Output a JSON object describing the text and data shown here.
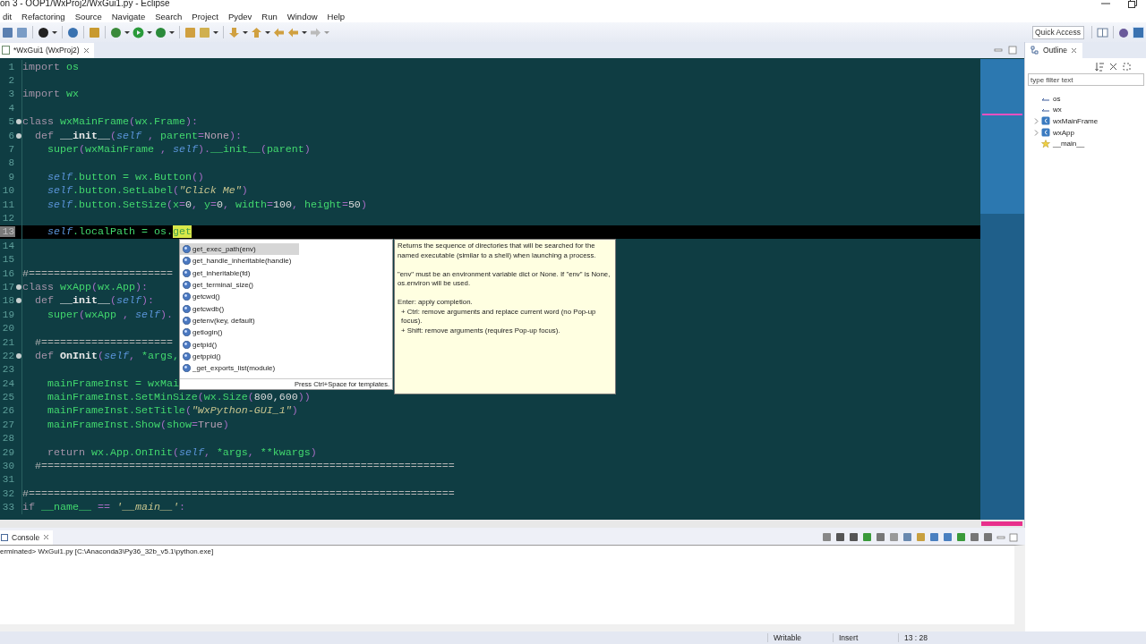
{
  "window": {
    "title": "on 3 - OOP1/WxProj2/WxGui1.py - Eclipse"
  },
  "menu": [
    "dit",
    "Refactoring",
    "Source",
    "Navigate",
    "Search",
    "Project",
    "Pydev",
    "Run",
    "Window",
    "Help"
  ],
  "quick_access": {
    "placeholder": "Quick Access"
  },
  "editor": {
    "tab": {
      "label": "*WxGui1 (WxProj2)",
      "selected": true
    },
    "lines": [
      {
        "n": "1",
        "fold": false,
        "current": false,
        "tokens": [
          {
            "t": "import ",
            "kind": "kw"
          },
          {
            "t": "os",
            "kind": "name"
          }
        ]
      },
      {
        "n": "2",
        "fold": false,
        "current": false
      },
      {
        "n": "3",
        "fold": false,
        "current": false,
        "tokens": [
          {
            "t": "import ",
            "kind": "kw"
          },
          {
            "t": "wx",
            "kind": "name"
          }
        ]
      },
      {
        "n": "4",
        "fold": false,
        "current": false
      },
      {
        "n": "5",
        "fold": true,
        "current": false,
        "tokens": [
          {
            "t": "class ",
            "kind": "kw"
          },
          {
            "t": "wxMainFrame",
            "kind": "name"
          },
          {
            "t": "(",
            "kind": "op"
          },
          {
            "t": "wx.Frame",
            "kind": "name"
          },
          {
            "t": "):",
            "kind": "op"
          }
        ]
      },
      {
        "n": "6",
        "fold": true,
        "current": false,
        "tokens": [
          {
            "t": "  def ",
            "kind": "kw"
          },
          {
            "t": "__init__",
            "kind": "fn"
          },
          {
            "t": "(",
            "kind": "op"
          },
          {
            "t": "self",
            "kind": "self"
          },
          {
            "t": " , ",
            "kind": "op"
          },
          {
            "t": "parent",
            "kind": "name"
          },
          {
            "t": "=",
            "kind": "op"
          },
          {
            "t": "None",
            "kind": "const"
          },
          {
            "t": "):",
            "kind": "op"
          }
        ]
      },
      {
        "n": "7",
        "fold": false,
        "current": false,
        "tokens": [
          {
            "t": "    super",
            "kind": "name"
          },
          {
            "t": "(",
            "kind": "op"
          },
          {
            "t": "wxMainFrame",
            "kind": "name"
          },
          {
            "t": " , ",
            "kind": "op"
          },
          {
            "t": "self",
            "kind": "self"
          },
          {
            "t": ").",
            "kind": "op"
          },
          {
            "t": "__init__",
            "kind": "name"
          },
          {
            "t": "(",
            "kind": "op"
          },
          {
            "t": "parent",
            "kind": "name"
          },
          {
            "t": ")",
            "kind": "op"
          }
        ]
      },
      {
        "n": "8",
        "fold": false,
        "current": false
      },
      {
        "n": "9",
        "fold": false,
        "current": false,
        "tokens": [
          {
            "t": "    self",
            "kind": "self"
          },
          {
            "t": ".button = wx.Button",
            "kind": "name"
          },
          {
            "t": "()",
            "kind": "op"
          }
        ]
      },
      {
        "n": "10",
        "fold": false,
        "current": false,
        "tokens": [
          {
            "t": "    self",
            "kind": "self"
          },
          {
            "t": ".button.SetLabel",
            "kind": "name"
          },
          {
            "t": "(",
            "kind": "op"
          },
          {
            "t": "\"Click Me\"",
            "kind": "str"
          },
          {
            "t": ")",
            "kind": "op"
          }
        ]
      },
      {
        "n": "11",
        "fold": false,
        "current": false,
        "tokens": [
          {
            "t": "    self",
            "kind": "self"
          },
          {
            "t": ".button.SetSize",
            "kind": "name"
          },
          {
            "t": "(",
            "kind": "op"
          },
          {
            "t": "x",
            "kind": "name"
          },
          {
            "t": "=",
            "kind": "op"
          },
          {
            "t": "0",
            "kind": "num"
          },
          {
            "t": ", ",
            "kind": "op"
          },
          {
            "t": "y",
            "kind": "name"
          },
          {
            "t": "=",
            "kind": "op"
          },
          {
            "t": "0",
            "kind": "num"
          },
          {
            "t": ", ",
            "kind": "op"
          },
          {
            "t": "width",
            "kind": "name"
          },
          {
            "t": "=",
            "kind": "op"
          },
          {
            "t": "100",
            "kind": "num"
          },
          {
            "t": ", ",
            "kind": "op"
          },
          {
            "t": "height",
            "kind": "name"
          },
          {
            "t": "=",
            "kind": "op"
          },
          {
            "t": "50",
            "kind": "num"
          },
          {
            "t": ")",
            "kind": "op"
          }
        ]
      },
      {
        "n": "12",
        "fold": false,
        "current": false
      },
      {
        "n": "13",
        "fold": false,
        "current": true,
        "tokens": [
          {
            "t": "    self",
            "kind": "self"
          },
          {
            "t": ".localPath = os.",
            "kind": "name"
          },
          {
            "t": "get",
            "kind": "hl"
          }
        ]
      },
      {
        "n": "14",
        "fold": false,
        "current": false
      },
      {
        "n": "15",
        "fold": false,
        "current": false
      },
      {
        "n": "16",
        "fold": false,
        "current": false,
        "tokens": [
          {
            "t": "#=======================",
            "kind": "comment"
          }
        ]
      },
      {
        "n": "17",
        "fold": true,
        "current": false,
        "tokens": [
          {
            "t": "class ",
            "kind": "kw"
          },
          {
            "t": "wxApp",
            "kind": "name"
          },
          {
            "t": "(",
            "kind": "op"
          },
          {
            "t": "wx.App",
            "kind": "name"
          },
          {
            "t": "):",
            "kind": "op"
          }
        ]
      },
      {
        "n": "18",
        "fold": true,
        "current": false,
        "tokens": [
          {
            "t": "  def ",
            "kind": "kw"
          },
          {
            "t": "__init__",
            "kind": "fn"
          },
          {
            "t": "(",
            "kind": "op"
          },
          {
            "t": "self",
            "kind": "self"
          },
          {
            "t": "):",
            "kind": "op"
          }
        ]
      },
      {
        "n": "19",
        "fold": false,
        "current": false,
        "tokens": [
          {
            "t": "    super",
            "kind": "name"
          },
          {
            "t": "(",
            "kind": "op"
          },
          {
            "t": "wxApp",
            "kind": "name"
          },
          {
            "t": " , ",
            "kind": "op"
          },
          {
            "t": "self",
            "kind": "self"
          },
          {
            "t": ").",
            "kind": "op"
          }
        ]
      },
      {
        "n": "20",
        "fold": false,
        "current": false
      },
      {
        "n": "21",
        "fold": false,
        "current": false,
        "tokens": [
          {
            "t": "  #=====================",
            "kind": "comment"
          }
        ]
      },
      {
        "n": "22",
        "fold": true,
        "current": false,
        "tokens": [
          {
            "t": "  def ",
            "kind": "kw"
          },
          {
            "t": "OnInit",
            "kind": "fn"
          },
          {
            "t": "(",
            "kind": "op"
          },
          {
            "t": "self",
            "kind": "self"
          },
          {
            "t": ", ",
            "kind": "op"
          },
          {
            "t": "*args,",
            "kind": "name"
          }
        ]
      },
      {
        "n": "23",
        "fold": false,
        "current": false
      },
      {
        "n": "24",
        "fold": false,
        "current": false,
        "tokens": [
          {
            "t": "    mainFrameInst = wxMai",
            "kind": "name"
          }
        ]
      },
      {
        "n": "25",
        "fold": false,
        "current": false,
        "tokens": [
          {
            "t": "    mainFrameInst.SetMinSize",
            "kind": "name"
          },
          {
            "t": "(",
            "kind": "op"
          },
          {
            "t": "wx.Size",
            "kind": "name"
          },
          {
            "t": "(",
            "kind": "op"
          },
          {
            "t": "800,600",
            "kind": "num"
          },
          {
            "t": "))",
            "kind": "op"
          }
        ]
      },
      {
        "n": "26",
        "fold": false,
        "current": false,
        "tokens": [
          {
            "t": "    mainFrameInst.SetTitle",
            "kind": "name"
          },
          {
            "t": "(",
            "kind": "op"
          },
          {
            "t": "\"WxPython-GUI_1\"",
            "kind": "str"
          },
          {
            "t": ")",
            "kind": "op"
          }
        ]
      },
      {
        "n": "27",
        "fold": false,
        "current": false,
        "tokens": [
          {
            "t": "    mainFrameInst.Show",
            "kind": "name"
          },
          {
            "t": "(",
            "kind": "op"
          },
          {
            "t": "show",
            "kind": "name"
          },
          {
            "t": "=",
            "kind": "op"
          },
          {
            "t": "True",
            "kind": "const"
          },
          {
            "t": ")",
            "kind": "op"
          }
        ]
      },
      {
        "n": "28",
        "fold": false,
        "current": false
      },
      {
        "n": "29",
        "fold": false,
        "current": false,
        "tokens": [
          {
            "t": "    return ",
            "kind": "kw"
          },
          {
            "t": "wx.App.OnInit",
            "kind": "name"
          },
          {
            "t": "(",
            "kind": "op"
          },
          {
            "t": "self",
            "kind": "self"
          },
          {
            "t": ", ",
            "kind": "op"
          },
          {
            "t": "*args",
            "kind": "name"
          },
          {
            "t": ", ",
            "kind": "op"
          },
          {
            "t": "**kwargs",
            "kind": "name"
          },
          {
            "t": ")",
            "kind": "op"
          }
        ]
      },
      {
        "n": "30",
        "fold": false,
        "current": false,
        "tokens": [
          {
            "t": "  #==================================================================",
            "kind": "comment"
          }
        ]
      },
      {
        "n": "31",
        "fold": false,
        "current": false
      },
      {
        "n": "32",
        "fold": false,
        "current": false,
        "tokens": [
          {
            "t": "#====================================================================",
            "kind": "comment"
          }
        ]
      },
      {
        "n": "33",
        "fold": false,
        "current": false,
        "tokens": [
          {
            "t": "if ",
            "kind": "kw"
          },
          {
            "t": "__name__",
            "kind": "name"
          },
          {
            "t": " == ",
            "kind": "op"
          },
          {
            "t": "'__main__'",
            "kind": "str"
          },
          {
            "t": ":",
            "kind": "op"
          }
        ]
      }
    ],
    "completions": {
      "items": [
        {
          "label": "get_exec_path(env)",
          "selected": true
        },
        {
          "label": "get_handle_inheritable(handle)",
          "selected": false
        },
        {
          "label": "get_inheritable(fd)",
          "selected": false
        },
        {
          "label": "get_terminal_size()",
          "selected": false
        },
        {
          "label": "getcwd()",
          "selected": false
        },
        {
          "label": "getcwdb()",
          "selected": false
        },
        {
          "label": "getenv(key, default)",
          "selected": false
        },
        {
          "label": "getlogin()",
          "selected": false
        },
        {
          "label": "getpid()",
          "selected": false
        },
        {
          "label": "getppid()",
          "selected": false
        },
        {
          "label": "_get_exports_list(module)",
          "selected": false
        }
      ],
      "footer": "Press Ctrl+Space for templates."
    },
    "doc": [
      [
        {
          "kind": "line",
          "text": "Returns the sequence of directories that will be searched for the named executable (similar to a shell) when launching a process."
        }
      ],
      [
        {
          "kind": "line",
          "text": "\"env\" must be an environment variable dict or None.  If \"env\" is None,"
        },
        {
          "kind": "line",
          "text": "os.environ will be used."
        }
      ],
      [
        {
          "kind": "line",
          "text": "Enter: apply completion."
        },
        {
          "kind": "bullet",
          "text": "+ Ctrl: remove arguments and replace current word (no Pop-up focus)."
        },
        {
          "kind": "bullet",
          "text": "+ Shift: remove arguments (requires Pop-up focus)."
        }
      ]
    ]
  },
  "outline": {
    "tab": {
      "label": "Outline",
      "selected": true
    },
    "filter": {
      "placeholder": "type filter text"
    },
    "items": [
      {
        "kind": "import",
        "label": "os"
      },
      {
        "kind": "import",
        "label": "wx"
      },
      {
        "kind": "class",
        "label": "wxMainFrame",
        "expanded": false
      },
      {
        "kind": "class",
        "label": "wxApp",
        "expanded": false
      },
      {
        "kind": "main",
        "label": "__main__"
      }
    ]
  },
  "console": {
    "tab": {
      "label": "Console",
      "selected": true
    },
    "line": "erminated> WxGui1.py [C:\\Anaconda3\\Py36_32b_v5.1\\python.exe]"
  },
  "status_bar": [
    "Writable",
    "Insert",
    "13 : 28"
  ]
}
